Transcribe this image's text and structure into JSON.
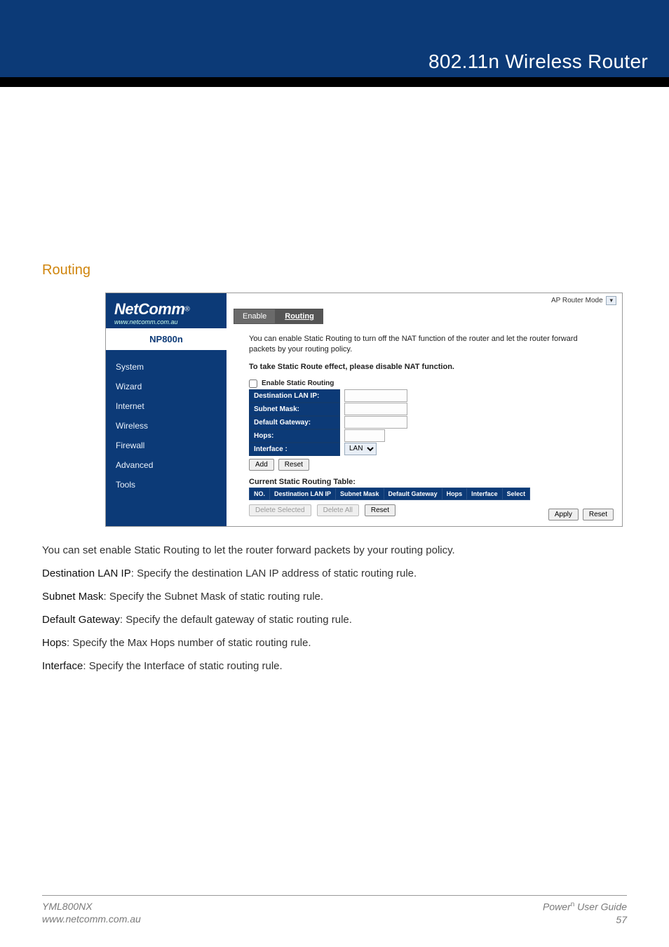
{
  "header": {
    "title": "802.11n Wireless Router"
  },
  "section": {
    "title": "Routing"
  },
  "screenshot": {
    "mode_label": "AP Router Mode",
    "logo": {
      "brand": "NetComm",
      "reg": "®",
      "url": "www.netcomm.com.au",
      "model": "NP800n"
    },
    "nav": [
      "System",
      "Wizard",
      "Internet",
      "Wireless",
      "Firewall",
      "Advanced",
      "Tools"
    ],
    "tabs": {
      "enable": "Enable",
      "routing": "Routing"
    },
    "desc1": "You can enable Static Routing to turn off the NAT function of the router and let the router forward packets by your routing policy.",
    "desc2": "To take Static Route effect, please disable NAT function.",
    "enable_check": "Enable Static Routing",
    "fields": {
      "dest_ip": "Destination LAN IP:",
      "subnet": "Subnet Mask:",
      "gateway": "Default Gateway:",
      "hops": "Hops:",
      "interface": "Interface :",
      "interface_value": "LAN"
    },
    "buttons": {
      "add": "Add",
      "reset": "Reset",
      "delete_selected": "Delete Selected",
      "delete_all": "Delete All",
      "apply": "Apply"
    },
    "table": {
      "title": "Current Static Routing Table:",
      "headers": [
        "NO.",
        "Destination LAN IP",
        "Subnet Mask",
        "Default Gateway",
        "Hops",
        "Interface",
        "Select"
      ]
    }
  },
  "body": {
    "intro": "You can set enable Static Routing to let the router forward packets by your routing policy.",
    "items": [
      {
        "label": "Destination LAN IP",
        "text": ": Specify the destination LAN IP address of static routing rule."
      },
      {
        "label": "Subnet Mask",
        "text": ": Specify the Subnet Mask of static routing rule."
      },
      {
        "label": "Default Gateway",
        "text": ": Specify the default gateway of static routing rule."
      },
      {
        "label": "Hops",
        "text": ": Specify the Max Hops number of static routing rule."
      },
      {
        "label": "Interface",
        "text": ": Specify the Interface of static routing rule."
      }
    ]
  },
  "footer": {
    "left_line1": "YML800NX",
    "left_line2": "www.netcomm.com.au",
    "right_brand": "Power",
    "right_sup": "n",
    "right_text": " User Guide",
    "page": "57"
  }
}
